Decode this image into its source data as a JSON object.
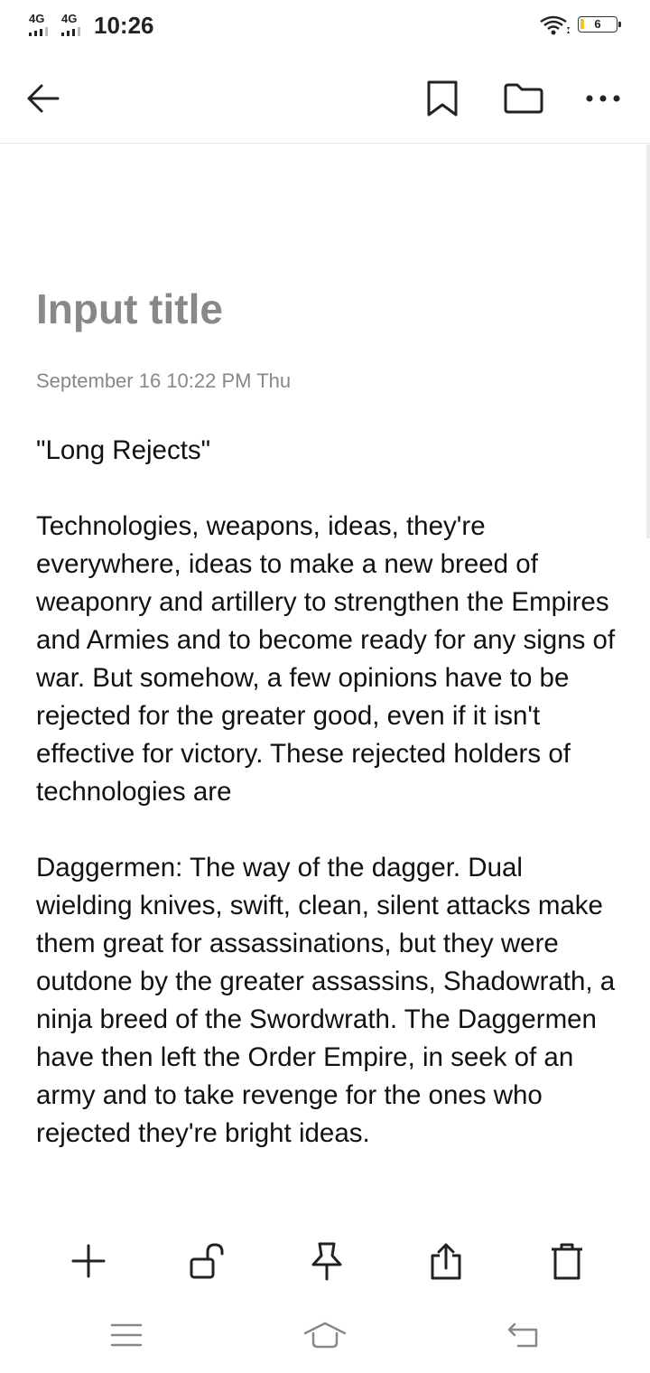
{
  "status_bar": {
    "signal_1": "4G",
    "signal_2": "4G",
    "time": "10:26",
    "battery": "6",
    "icons": [
      "signal-icon",
      "wifi-icon",
      "battery-icon"
    ]
  },
  "toolbar": {
    "icons": [
      "back-arrow-icon",
      "bookmark-icon",
      "folder-icon",
      "more-icon"
    ]
  },
  "note": {
    "title_placeholder": "Input title",
    "date": "September 16 10:22 PM Thu",
    "paragraphs": [
      "\"Long Rejects\"",
      "Technologies, weapons, ideas, they're everywhere, ideas to make a new breed of weaponry and artillery to strengthen the Empires and Armies and to become ready for any signs of war. But somehow, a few opinions have to be rejected for the greater good, even if it isn't effective for victory. These rejected holders of technologies are",
      "Daggermen: The way of the dagger. Dual wielding knives, swift, clean, silent attacks make them great for assassinations, but they were outdone by the greater assassins, Shadowrath, a ninja breed of the Swordwrath. The Daggermen have then left the Order Empire, in seek of an army and to take revenge for the ones who rejected they're bright ideas."
    ]
  },
  "bottom_actions": {
    "icons": [
      "add-icon",
      "unlock-icon",
      "pin-icon",
      "share-icon",
      "delete-icon"
    ]
  },
  "nav_bar": {
    "icons": [
      "menu-icon",
      "home-icon",
      "back-icon"
    ]
  },
  "colors": {
    "title_placeholder": "#888888",
    "date": "#888888",
    "body_text": "#111111",
    "icon": "#222222",
    "battery_fill": "#f0c419"
  }
}
